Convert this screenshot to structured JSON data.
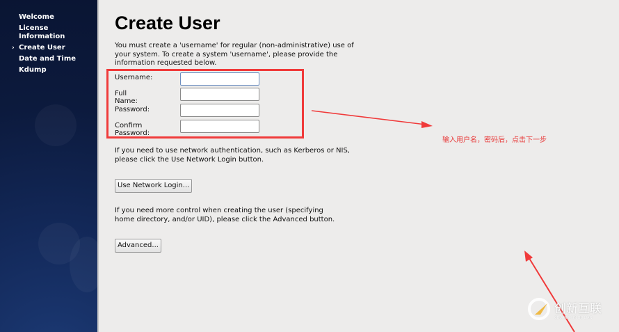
{
  "sidebar": {
    "items": [
      {
        "label": "Welcome"
      },
      {
        "label": "License Information"
      },
      {
        "label": "Create User",
        "active": true
      },
      {
        "label": "Date and Time"
      },
      {
        "label": "Kdump"
      }
    ]
  },
  "main": {
    "title": "Create User",
    "intro": "You must create a 'username' for regular (non-administrative) use of your system.  To create a system 'username', please provide the information requested below.",
    "fields": [
      {
        "label": "Username:",
        "value": ""
      },
      {
        "label": "Full Name:",
        "value": ""
      },
      {
        "label": "Password:",
        "value": ""
      },
      {
        "label": "Confirm Password:",
        "value": ""
      }
    ],
    "network_text": "If you need to use network authentication, such as Kerberos or NIS, please click the Use Network Login button.",
    "network_button": "Use Network Login...",
    "advanced_text": "If you need more control when creating the user (specifying home directory, and/or UID), please click the Advanced button.",
    "advanced_button": "Advanced..."
  },
  "annotation": {
    "note": "输入用户名，密码后，点击下一步",
    "color": "#f03a3a"
  },
  "watermark": {
    "text": "创新互联",
    "sub": "CHUANG XIN HU LIAN"
  }
}
